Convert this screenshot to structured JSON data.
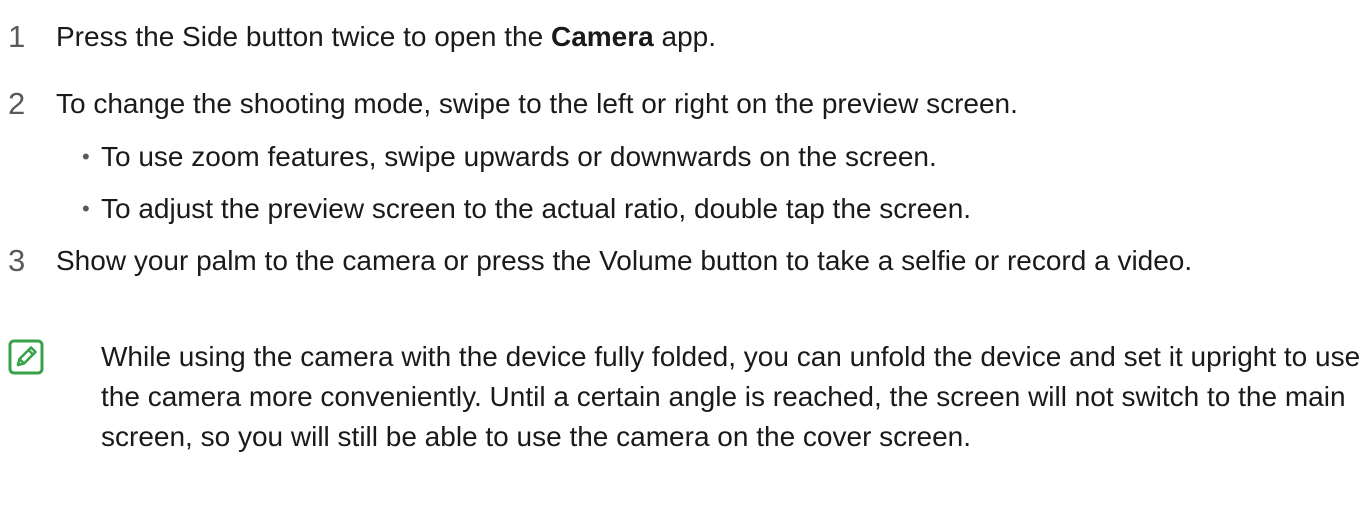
{
  "steps": [
    {
      "number": "1",
      "text_before": "Press the Side button twice to open the ",
      "bold": "Camera",
      "text_after": " app."
    },
    {
      "number": "2",
      "text": "To change the shooting mode, swipe to the left or right on the preview screen.",
      "bullets": [
        "To use zoom features, swipe upwards or downwards on the screen.",
        "To adjust the preview screen to the actual ratio, double tap the screen."
      ]
    },
    {
      "number": "3",
      "text": "Show your palm to the camera or press the Volume button to take a selfie or record a video."
    }
  ],
  "bullet_symbol": "•",
  "note": {
    "icon": "note-pencil-icon",
    "text": "While using the camera with the device fully folded, you can unfold the device and set it upright to use the camera more conveniently. Until a certain angle is reached, the screen will not switch to the main screen, so you will still be able to use the camera on the cover screen."
  },
  "colors": {
    "text": "#1a1a1a",
    "step_number": "#5a5a5a",
    "note_icon": "#3aa14b"
  }
}
